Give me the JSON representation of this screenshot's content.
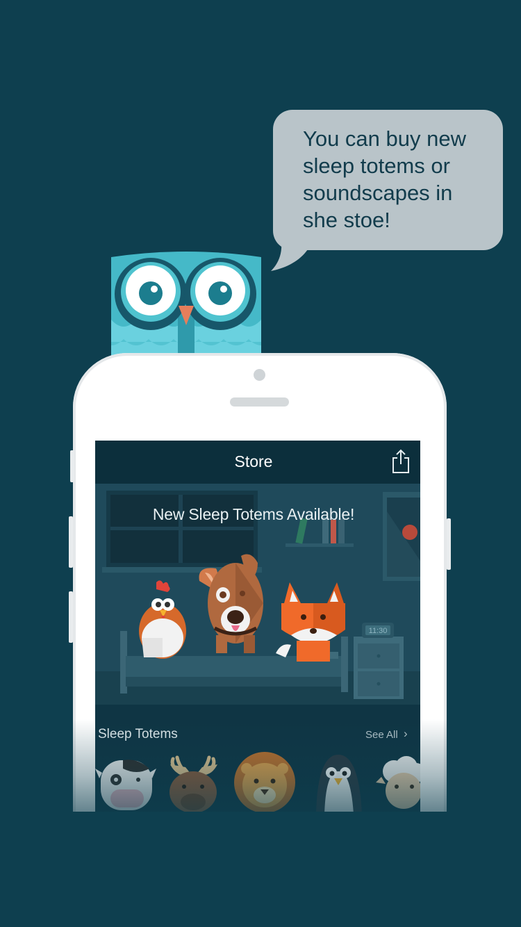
{
  "bubble": {
    "text": "You can buy new sleep totems or soundscapes in she stoe!"
  },
  "store": {
    "title": "Store",
    "banner_title": "New Sleep Totems Available!",
    "clock_time": "11:30",
    "section_title": "Sleep Totems",
    "see_all_label": "See All",
    "see_all_chevron": "›",
    "totems": [
      "cow",
      "moose",
      "lion",
      "penguin",
      "sheep"
    ]
  },
  "colors": {
    "background": "#0e3f4f",
    "bubble": "#b9c4c9",
    "owl_body": "#45b9c8",
    "owl_light": "#6ad1df",
    "fox": "#f06a2a",
    "dog": "#b0693f",
    "chicken": "#d6692b"
  }
}
